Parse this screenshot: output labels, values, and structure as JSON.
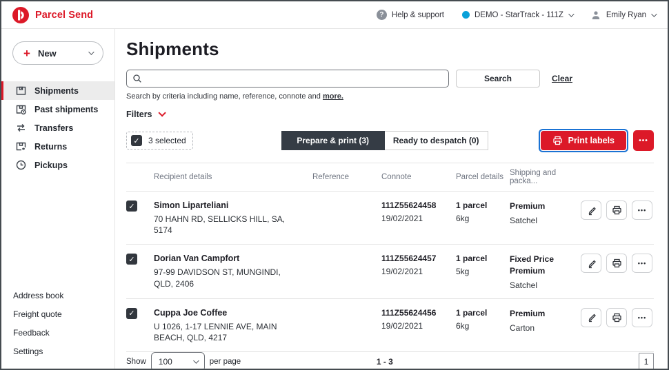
{
  "header": {
    "app_name": "Parcel Send",
    "help_label": "Help & support",
    "account_label": "DEMO - StarTrack - 111Z",
    "user_label": "Emily Ryan"
  },
  "sidebar": {
    "new_button_label": "New",
    "items": [
      {
        "label": "Shipments"
      },
      {
        "label": "Past shipments"
      },
      {
        "label": "Transfers"
      },
      {
        "label": "Returns"
      },
      {
        "label": "Pickups"
      }
    ],
    "footer_items": [
      {
        "label": "Address book"
      },
      {
        "label": "Freight quote"
      },
      {
        "label": "Feedback"
      },
      {
        "label": "Settings"
      }
    ]
  },
  "main": {
    "title": "Shipments",
    "search": {
      "button_label": "Search",
      "clear_label": "Clear",
      "hint_prefix": "Search by criteria including name, reference, connote and ",
      "hint_link": "more."
    },
    "filters_label": "Filters",
    "selected_label": "3 selected",
    "tabs": [
      {
        "label": "Prepare & print (3)"
      },
      {
        "label": "Ready to despatch (0)"
      }
    ],
    "print_labels_label": "Print labels",
    "table": {
      "headers": [
        "Recipient details",
        "Reference",
        "Connote",
        "Parcel details",
        "Shipping and packa..."
      ],
      "rows": [
        {
          "name": "Simon Liparteliani",
          "address": "70 HAHN RD, SELLICKS HILL, SA, 5174",
          "reference": "",
          "connote": "111Z55624458",
          "date": "19/02/2021",
          "parcels": "1 parcel",
          "weight": "6kg",
          "service": "Premium",
          "packaging": "Satchel"
        },
        {
          "name": "Dorian Van Campfort",
          "address": "97-99 DAVIDSON ST, MUNGINDI, QLD, 2406",
          "reference": "",
          "connote": "111Z55624457",
          "date": "19/02/2021",
          "parcels": "1 parcel",
          "weight": "5kg",
          "service": "Fixed Price Premium",
          "packaging": "Satchel"
        },
        {
          "name": "Cuppa Joe Coffee",
          "address": "U 1026, 1-17 LENNIE AVE, MAIN BEACH, QLD, 4217",
          "reference": "",
          "connote": "111Z55624456",
          "date": "19/02/2021",
          "parcels": "1 parcel",
          "weight": "6kg",
          "service": "Premium",
          "packaging": "Carton"
        }
      ]
    },
    "pagination": {
      "show_label": "Show",
      "page_size": "100",
      "per_page_label": "per page",
      "range": "1 - 3",
      "page": "1"
    }
  },
  "icons": {
    "plus": "+",
    "question": "?",
    "check": "✓",
    "ellipsis": "•••"
  },
  "colors": {
    "brand_red": "#dc1928",
    "dark": "#353c45",
    "focus_blue": "#1a73d4",
    "account_dot": "#09a1d9"
  }
}
